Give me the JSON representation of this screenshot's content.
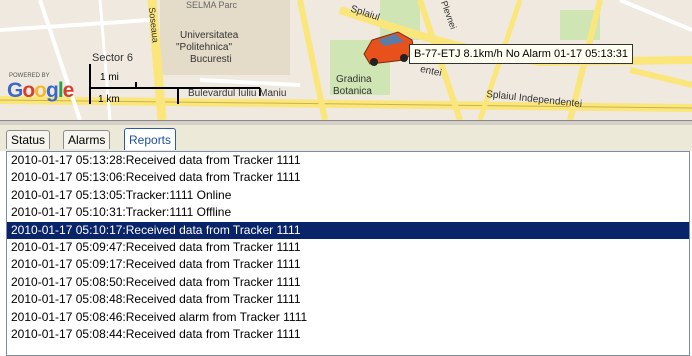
{
  "map": {
    "labels": {
      "selma_parc": "SELMA Parc",
      "universitatea": "Universitatea",
      "politehnica": "\"Politehnica\"",
      "bucuresti": "Bucuresti",
      "sector6": "Sector 6",
      "gradina": "Gradina",
      "botanica": "Botanica",
      "bulevardul": "Bulevardul Iuliu Maniu",
      "splaiul_top": "Splaiul",
      "splaiul_bottom": "Splaiul Independentei",
      "independentei_mid": "entei",
      "soseaua": "Soseaua",
      "plevnei": "Plevnei"
    },
    "tooltip": "B-77-ETJ 8.1km/h No Alarm 01-17 05:13:31",
    "scale": {
      "miles": "1 mi",
      "km": "1 km"
    },
    "logo": {
      "powered_by": "POWERED BY",
      "google": "Google"
    },
    "colors": {
      "road": "#fbe67b",
      "park": "#cfe6b4",
      "building": "#e4dcc8",
      "car": "#e8501c"
    }
  },
  "tabs": [
    {
      "label": "Status",
      "active": false
    },
    {
      "label": "Alarms",
      "active": false
    },
    {
      "label": "Reports",
      "active": true
    }
  ],
  "reports": [
    {
      "text": "2010-01-17 05:13:28:Received data from Tracker 1111",
      "selected": false
    },
    {
      "text": "2010-01-17 05:13:06:Received data from Tracker 1111",
      "selected": false
    },
    {
      "text": "2010-01-17 05:13:05:Tracker:1111 Online",
      "selected": false
    },
    {
      "text": "2010-01-17 05:10:31:Tracker:1111 Offline",
      "selected": false
    },
    {
      "text": "2010-01-17 05:10:17:Received data from Tracker 1111",
      "selected": true
    },
    {
      "text": "2010-01-17 05:09:47:Received data from Tracker 1111",
      "selected": false
    },
    {
      "text": "2010-01-17 05:09:17:Received data from Tracker 1111",
      "selected": false
    },
    {
      "text": "2010-01-17 05:08:50:Received data from Tracker 1111",
      "selected": false
    },
    {
      "text": "2010-01-17 05:08:48:Received data from Tracker 1111",
      "selected": false
    },
    {
      "text": "2010-01-17 05:08:46:Received alarm from Tracker 1111",
      "selected": false
    },
    {
      "text": "2010-01-17 05:08:44:Received data from Tracker 1111",
      "selected": false
    }
  ]
}
